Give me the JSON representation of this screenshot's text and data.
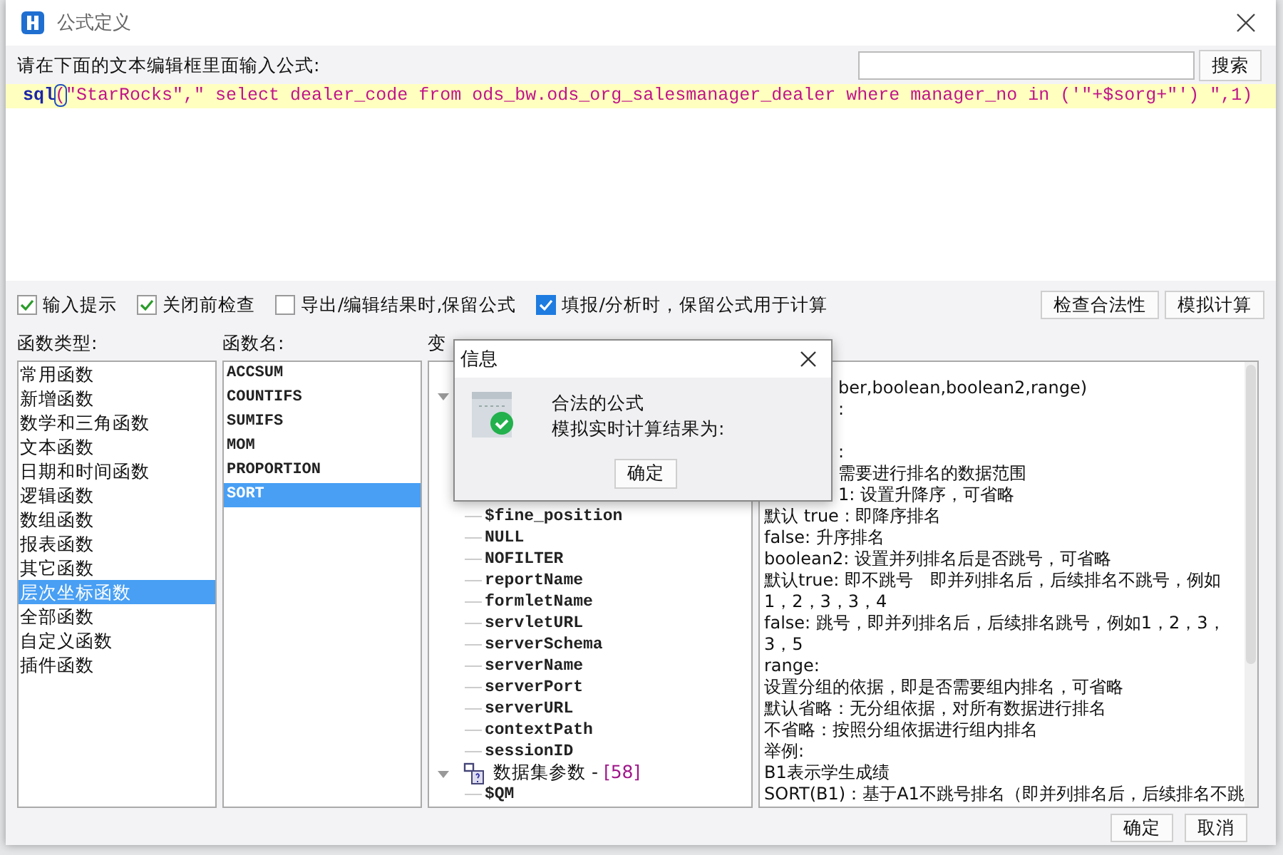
{
  "window": {
    "title": "公式定义"
  },
  "prompt": "请在下面的文本编辑框里面输入公式:",
  "search": {
    "button": "搜索"
  },
  "formula": [
    {
      "kind": "keyword",
      "text": "sql"
    },
    {
      "kind": "bracket",
      "text": "("
    },
    {
      "kind": "string",
      "text": "\"StarRocks\",\" select dealer_code from ods_bw.ods_org_salesmanager_dealer where manager_no in ('\"+$sorg+\"') \",1)"
    }
  ],
  "options": [
    {
      "label": "输入提示",
      "checked": true,
      "focused": false
    },
    {
      "label": "关闭前检查",
      "checked": true,
      "focused": false
    },
    {
      "label": "导出/编辑结果时,保留公式",
      "checked": false,
      "focused": false
    },
    {
      "label": "填报/分析时，保留公式用于计算",
      "checked": true,
      "focused": true
    }
  ],
  "actions": [
    "检查合法性",
    "模拟计算"
  ],
  "categories": {
    "label": "函数类型:",
    "items": [
      {
        "label": "常用函数",
        "selected": false
      },
      {
        "label": "新增函数",
        "selected": false
      },
      {
        "label": "数学和三角函数",
        "selected": false
      },
      {
        "label": "文本函数",
        "selected": false
      },
      {
        "label": "日期和时间函数",
        "selected": false
      },
      {
        "label": "逻辑函数",
        "selected": false
      },
      {
        "label": "数组函数",
        "selected": false
      },
      {
        "label": "报表函数",
        "selected": false
      },
      {
        "label": "其它函数",
        "selected": false
      },
      {
        "label": "层次坐标函数",
        "selected": true
      },
      {
        "label": "全部函数",
        "selected": false
      },
      {
        "label": "自定义函数",
        "selected": false
      },
      {
        "label": "插件函数",
        "selected": false
      }
    ]
  },
  "functions": {
    "label": "函数名:",
    "items": [
      {
        "label": "ACCSUM",
        "selected": false
      },
      {
        "label": "COUNTIFS",
        "selected": false
      },
      {
        "label": "SUMIFS",
        "selected": false
      },
      {
        "label": "MOM",
        "selected": false
      },
      {
        "label": "PROPORTION",
        "selected": false
      },
      {
        "label": "SORT",
        "selected": true
      }
    ]
  },
  "variables": {
    "label": "变",
    "tree": [
      {
        "expanded": true,
        "children": [
          {
            "label": "$fine_position"
          },
          {
            "label": "NULL"
          },
          {
            "label": "NOFILTER"
          },
          {
            "label": "reportName"
          },
          {
            "label": "formletName"
          },
          {
            "label": "servletURL"
          },
          {
            "label": "serverSchema"
          },
          {
            "label": "serverName"
          },
          {
            "label": "serverPort"
          },
          {
            "label": "serverURL"
          },
          {
            "label": "contextPath"
          },
          {
            "label": "sessionID"
          }
        ]
      },
      {
        "label": "数据集参数 - ",
        "count": "[58]",
        "expanded": true,
        "children": [
          {
            "label": "$QM"
          }
        ]
      }
    ]
  },
  "doc": [
    {
      "kind": "partial",
      "text": "ber,boolean,boolean2,range)"
    },
    {
      "kind": "partial",
      "text": ":"
    },
    {
      "kind": "blank"
    },
    {
      "kind": "partial",
      "text": ":"
    },
    {
      "kind": "partial",
      "text": "  需要进行排名的数据范围"
    },
    {
      "kind": "partial",
      "text": "1: 设置升降序，可省略"
    },
    {
      "kind": "line",
      "text": "默认 true : 即降序排名"
    },
    {
      "kind": "line",
      "text": " false: 升序排名"
    },
    {
      "kind": "line",
      "text": " boolean2: 设置并列排名后是否跳号，可省略"
    },
    {
      "kind": "line",
      "text": "默认true: 即不跳号　即并列排名后，后续排名不跳号，例如"
    },
    {
      "kind": "line",
      "text": "1，2，3，3，4"
    },
    {
      "kind": "line",
      "text": " false: 跳号，即并列排名后，后续排名跳号，例如1，2，3，"
    },
    {
      "kind": "line",
      "text": "3，5"
    },
    {
      "kind": "line",
      "text": " range:"
    },
    {
      "kind": "line",
      "text": "设置分组的依据，即是否需要组内排名，可省略"
    },
    {
      "kind": "line",
      "text": "默认省略：无分组依据，对所有数据进行排名"
    },
    {
      "kind": "line",
      "text": "不省略：按照分组依据进行组内排名"
    },
    {
      "kind": "line",
      "text": "举例:"
    },
    {
      "kind": "line",
      "text": " B1表示学生成绩"
    },
    {
      "kind": "line",
      "text": " SORT(B1)：基于A1不跳号排名（即并列排名后，后续排名不跳"
    }
  ],
  "footer": [
    "确定",
    "取消"
  ],
  "message": {
    "title": "信息",
    "lines": [
      "合法的公式",
      "模拟实时计算结果为:"
    ],
    "button": "确定"
  }
}
